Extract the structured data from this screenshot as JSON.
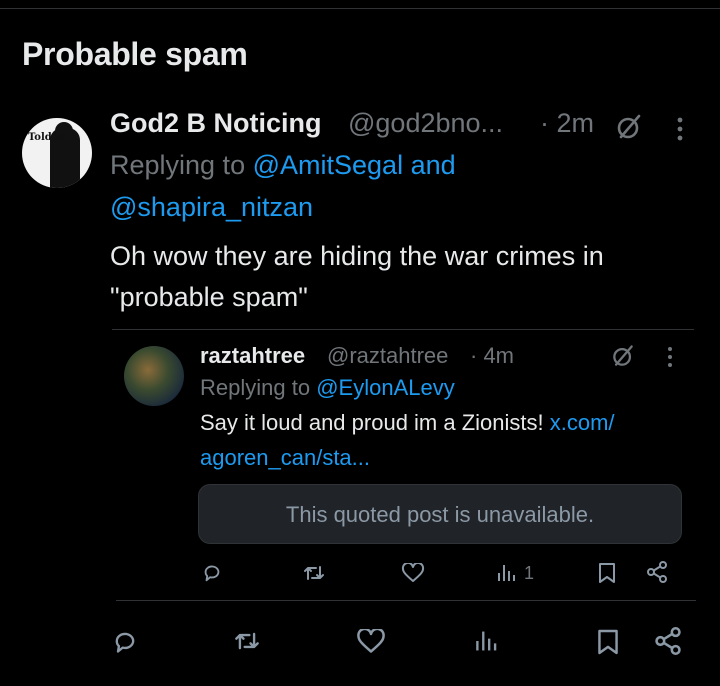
{
  "section_title": "Probable spam",
  "tweet": {
    "author_name": "God2 B Noticing",
    "handle": "@god2bno...",
    "time": "· 2m",
    "replying_prefix": "Replying to",
    "mention1": "@AmitSegal",
    "and_word": "and",
    "mention2": "@shapira_nitzan",
    "body_line1": "Oh wow they are hiding the war crimes in",
    "body_line2": "\"probable spam\"",
    "avatar_text": "Told ya"
  },
  "quoted": {
    "author_name": "raztahtree",
    "handle": "@raztahtree",
    "time": "· 4m",
    "replying_prefix": "Replying to",
    "mention": "@EylonALevy",
    "text_prefix": "Say it loud and proud im a Zionists!",
    "link_part1": "x.com/",
    "link_part2": "agoren_can/sta...",
    "unavailable": "This quoted post is unavailable.",
    "views": "1"
  },
  "icons": {
    "reply": "reply-icon",
    "retweet": "retweet-icon",
    "like": "heart-icon",
    "views": "views-icon",
    "bookmark": "bookmark-icon",
    "share": "share-icon",
    "grok": "grok-icon",
    "more": "more-icon"
  },
  "colors": {
    "background": "#000000",
    "text": "#e7e9ea",
    "muted": "#71767b",
    "accent": "#1d9bf0",
    "divider": "#2f3336"
  }
}
